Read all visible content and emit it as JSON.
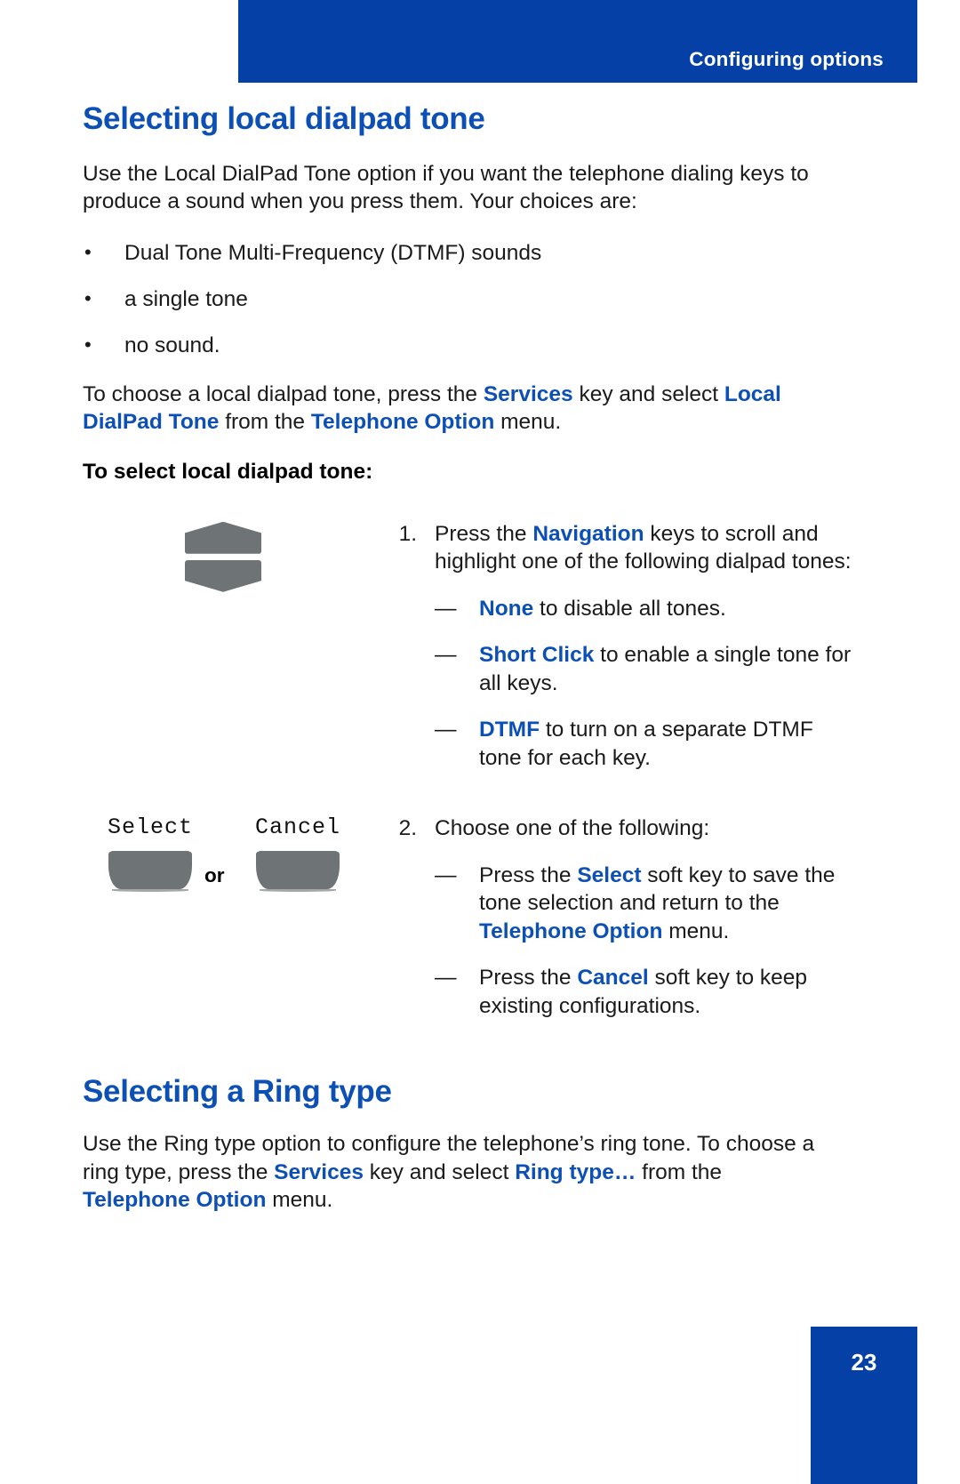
{
  "header": {
    "title": "Configuring options",
    "bar_color": "#0540a6"
  },
  "theme": {
    "accent_blue": "#0d50b5",
    "header_blue": "#0540a6",
    "key_gray": "#6e7376"
  },
  "section_1": {
    "title": "Selecting local dialpad tone",
    "intro": {
      "part1": "Use the Local DialPad Tone option if you want the telephone dialing keys to produce a sound when you press them. Your choices are:"
    },
    "bullets": [
      "Dual Tone Multi-Frequency (DTMF) sounds",
      "a single tone",
      "no sound."
    ],
    "instruction": {
      "t1": "To choose a local dialpad tone, press the ",
      "b1": "Services",
      "t2": " key and select ",
      "b2": "Local DialPad Tone",
      "t3": " from the ",
      "b3": "Telephone Option",
      "t4": " menu."
    },
    "procedure_heading": "To select local dialpad tone:",
    "steps": [
      {
        "number": "1.",
        "text_1": "Press the ",
        "blue_1": "Navigation",
        "text_2": " keys to scroll and highlight one of the following dialpad tones:",
        "sub_items": [
          {
            "blue": "None",
            "rest": " to disable all tones."
          },
          {
            "blue": "Short Click",
            "rest": " to enable a single tone for all keys."
          },
          {
            "blue": "DTMF",
            "rest": " to turn on a separate DTMF tone for each key."
          }
        ]
      },
      {
        "number": "2.",
        "text_1": "Choose one of the following:",
        "sub_items": [
          {
            "t1": "Press the ",
            "b1": "Select",
            "t2": " soft key to save the tone selection and return to the ",
            "b2": "Telephone Option",
            "t3": " menu."
          },
          {
            "t1": "Press the ",
            "b1": "Cancel",
            "t2": " soft key to keep existing configurations.",
            "b2": "",
            "t3": ""
          }
        ]
      }
    ],
    "graphics": {
      "nav_keys": {
        "up_label": "navigation-up-key",
        "down_label": "navigation-down-key"
      },
      "softkeys": {
        "select_label": "Select",
        "cancel_label": "Cancel",
        "or_label": "or"
      }
    }
  },
  "section_2": {
    "title": "Selecting a Ring type",
    "body": {
      "t1": "Use the Ring type option to configure the telephone’s ring tone. To choose a ring type, press the ",
      "b1": "Services",
      "t2": " key and select ",
      "b2": "Ring type…",
      "t3": " from the ",
      "b3": "Telephone Option",
      "t4": " menu."
    }
  },
  "footer": {
    "page_number": "23"
  }
}
